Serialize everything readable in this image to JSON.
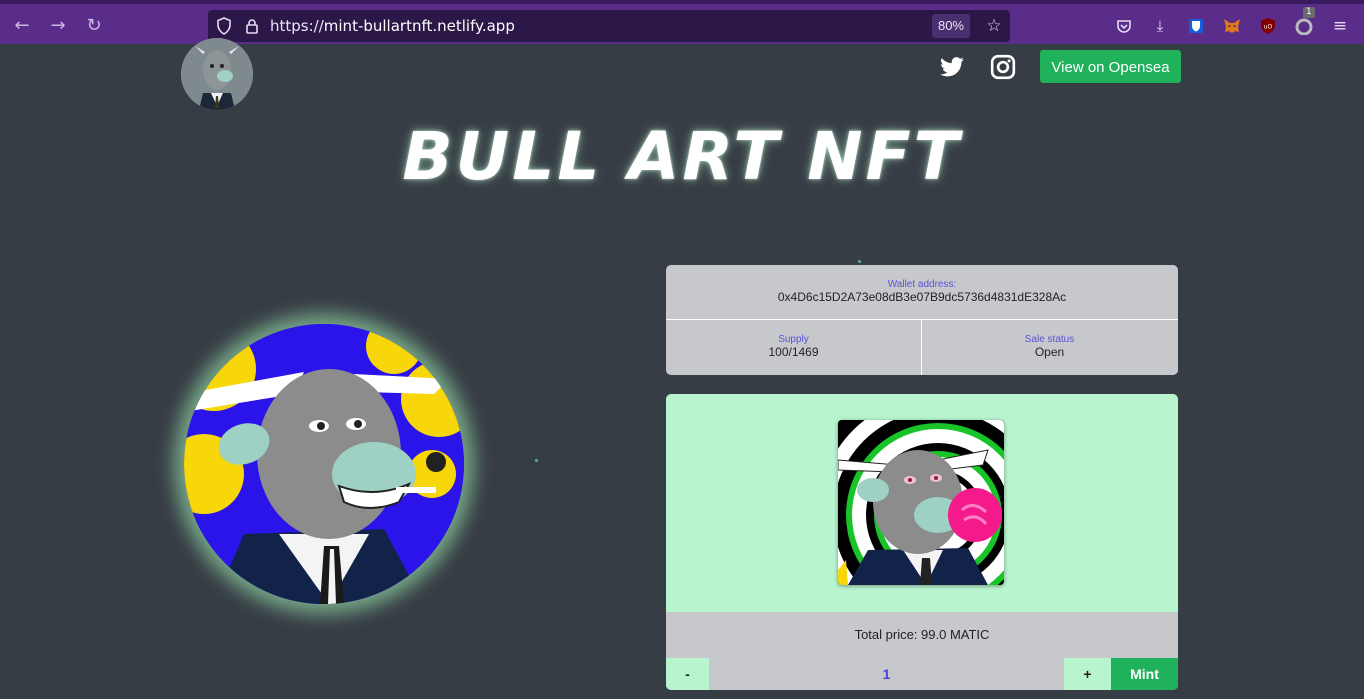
{
  "browser": {
    "url_scheme": "https://",
    "url_host": "mint-bullartnft.netlify.app",
    "zoom": "80%",
    "extension_badge": "1"
  },
  "header": {
    "opensea_button": "View on Opensea"
  },
  "title": "BULL ART NFT",
  "wallet": {
    "label": "Wallet address:",
    "address": "0x4D6c15D2A73e08dB3e07B9dc5736d4831dE328Ac"
  },
  "stats": {
    "supply_label": "Supply",
    "supply_value": "100/1469",
    "status_label": "Sale status",
    "status_value": "Open"
  },
  "mint": {
    "price_text": "Total price: 99.0 MATIC",
    "decrement": "-",
    "quantity": "1",
    "increment": "+",
    "mint_button": "Mint"
  },
  "colors": {
    "page_bg": "#373d45",
    "browser_chrome": "#5b2d8a",
    "accent_green": "#1fb25a",
    "mint_card_bg": "#b8f5cf",
    "label_purple": "#5a52d9"
  }
}
